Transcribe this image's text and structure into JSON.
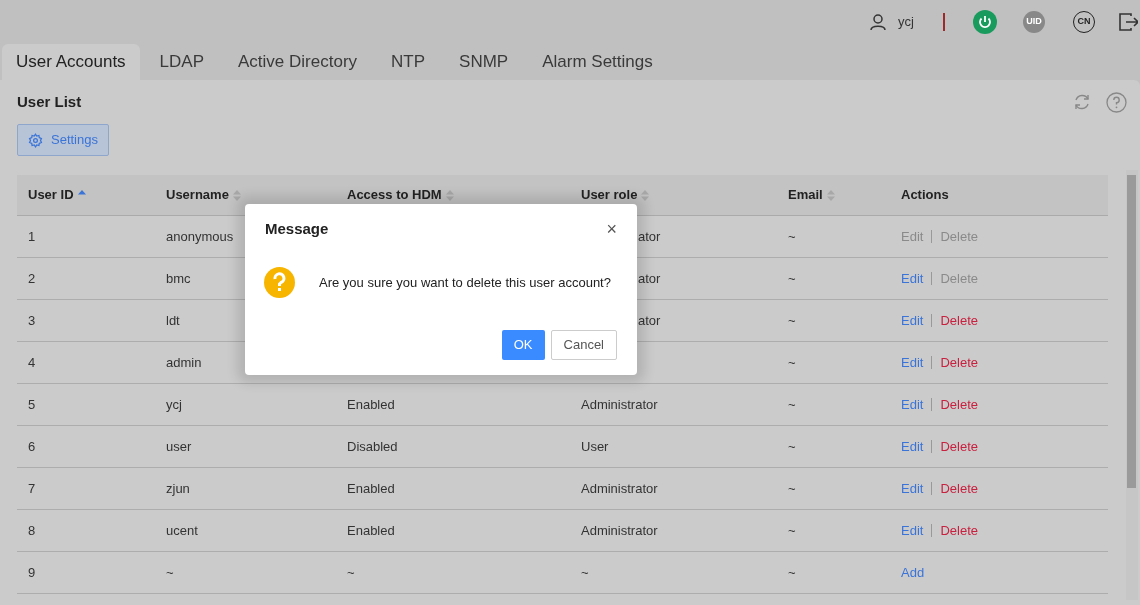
{
  "header": {
    "username": "ycj",
    "uid_label": "UID",
    "language": "CN"
  },
  "tabs": [
    {
      "label": "User Accounts",
      "selected": true
    },
    {
      "label": "LDAP",
      "selected": false
    },
    {
      "label": "Active Directory",
      "selected": false
    },
    {
      "label": "NTP",
      "selected": false
    },
    {
      "label": "SNMP",
      "selected": false
    },
    {
      "label": "Alarm Settings",
      "selected": false
    }
  ],
  "panel": {
    "title": "User List",
    "settings_button": "Settings"
  },
  "table": {
    "columns": [
      {
        "label": "User ID",
        "sortable": true,
        "sorted": true
      },
      {
        "label": "Username",
        "sortable": true,
        "sorted": false
      },
      {
        "label": "Access to HDM",
        "sortable": true,
        "sorted": false
      },
      {
        "label": "User role",
        "sortable": true,
        "sorted": false
      },
      {
        "label": "Email",
        "sortable": true,
        "sorted": false
      },
      {
        "label": "Actions"
      }
    ],
    "rows": [
      {
        "id": "1",
        "username": "anonymous",
        "role_fragment": "ator",
        "email": "~",
        "actions": [
          {
            "label": "Edit",
            "kind": "edit",
            "disabled": true
          },
          {
            "label": "Delete",
            "kind": "delete",
            "disabled": true
          }
        ]
      },
      {
        "id": "2",
        "username": "bmc",
        "role_fragment": "ator",
        "email": "~",
        "actions": [
          {
            "label": "Edit",
            "kind": "edit",
            "disabled": false
          },
          {
            "label": "Delete",
            "kind": "delete",
            "disabled": true
          }
        ]
      },
      {
        "id": "3",
        "username": "ldt",
        "role_fragment": "ator",
        "email": "~",
        "actions": [
          {
            "label": "Edit",
            "kind": "edit",
            "disabled": false
          },
          {
            "label": "Delete",
            "kind": "delete",
            "disabled": false
          }
        ]
      },
      {
        "id": "4",
        "username": "admin",
        "email": "~",
        "actions": [
          {
            "label": "Edit",
            "kind": "edit",
            "disabled": false
          },
          {
            "label": "Delete",
            "kind": "delete",
            "disabled": false
          }
        ]
      },
      {
        "id": "5",
        "username": "ycj",
        "access": "Enabled",
        "role": "Administrator",
        "email": "~",
        "actions": [
          {
            "label": "Edit",
            "kind": "edit",
            "disabled": false
          },
          {
            "label": "Delete",
            "kind": "delete",
            "disabled": false
          }
        ]
      },
      {
        "id": "6",
        "username": "user",
        "access": "Disabled",
        "role": "User",
        "email": "~",
        "actions": [
          {
            "label": "Edit",
            "kind": "edit",
            "disabled": false
          },
          {
            "label": "Delete",
            "kind": "delete",
            "disabled": false
          }
        ]
      },
      {
        "id": "7",
        "username": "zjun",
        "access": "Enabled",
        "role": "Administrator",
        "email": "~",
        "actions": [
          {
            "label": "Edit",
            "kind": "edit",
            "disabled": false
          },
          {
            "label": "Delete",
            "kind": "delete",
            "disabled": false
          }
        ]
      },
      {
        "id": "8",
        "username": "ucent",
        "access": "Enabled",
        "role": "Administrator",
        "email": "~",
        "actions": [
          {
            "label": "Edit",
            "kind": "edit",
            "disabled": false
          },
          {
            "label": "Delete",
            "kind": "delete",
            "disabled": false
          }
        ]
      },
      {
        "id": "9",
        "username": "~",
        "access": "~",
        "role": "~",
        "email": "~",
        "actions": [
          {
            "label": "Add",
            "kind": "add",
            "disabled": false
          }
        ]
      }
    ]
  },
  "dialog": {
    "title": "Message",
    "close": "×",
    "message": "Are you sure you want to delete this user account?",
    "ok": "OK",
    "cancel": "Cancel"
  }
}
